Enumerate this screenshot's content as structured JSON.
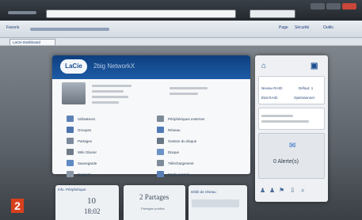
{
  "browser": {
    "tab_title": "LaCie Dashboard",
    "favorites_label": "Favoris",
    "toolbar_page": "Page",
    "toolbar_security": "Sécurité",
    "toolbar_tools": "Outils"
  },
  "main": {
    "logo": "LaCie",
    "device_name": "2big NetworkX",
    "menu_left": [
      {
        "label": "Utilisateurs",
        "icon": "users-icon"
      },
      {
        "label": "Groupes",
        "icon": "groups-icon"
      },
      {
        "label": "Partages",
        "icon": "shares-icon"
      },
      {
        "label": "Wiki Glacier",
        "icon": "wiki-icon"
      },
      {
        "label": "Sauvegarde",
        "icon": "backup-icon"
      },
      {
        "label": "Support",
        "icon": "support-icon"
      }
    ],
    "menu_right": [
      {
        "label": "Périphériques externes",
        "icon": "external-devices-icon"
      },
      {
        "label": "Réseau",
        "icon": "network-icon"
      },
      {
        "label": "Gestion du disque",
        "icon": "disk-icon"
      },
      {
        "label": "Disque",
        "icon": "drive-icon"
      },
      {
        "label": "Téléchargement",
        "icon": "download-icon"
      },
      {
        "label": "Mode avancé",
        "icon": "advanced-icon"
      }
    ]
  },
  "side": {
    "raid_label": "Niveau RAID:",
    "raid_value": "Défaut: 1",
    "disk_label": "État RAID:",
    "disk_value": "Opérationnel",
    "alerts": "0 Alerte(s)"
  },
  "widgets": {
    "info_title": "Info. Périphérique",
    "time_value": "10",
    "time_value2": "18:02",
    "shares_count": "2 Partages",
    "shares_sub": "Partages publics",
    "network_title": "Débit de réseau"
  },
  "badge": "2"
}
